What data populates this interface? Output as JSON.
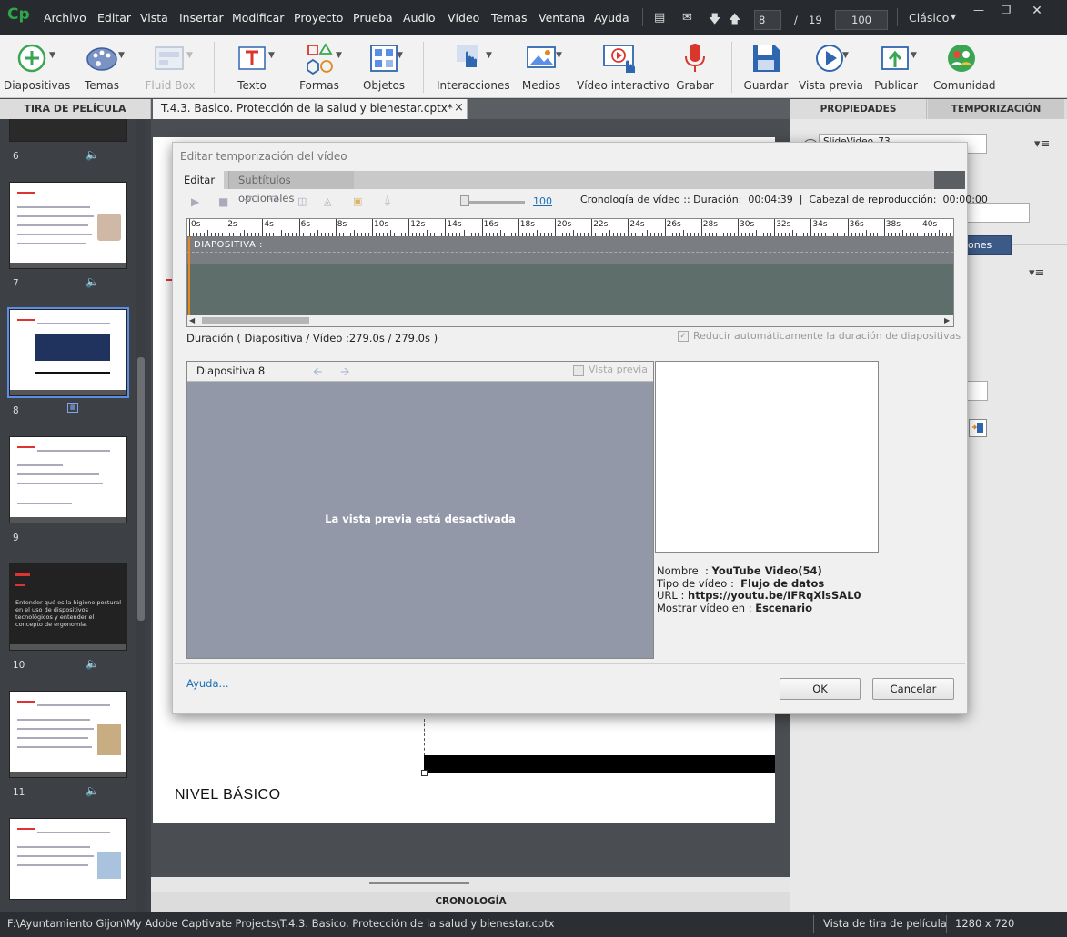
{
  "menubar": {
    "logo": "Cp",
    "items": [
      "Archivo",
      "Editar",
      "Vista",
      "Insertar",
      "Modificar",
      "Proyecto",
      "Prueba",
      "Audio",
      "Vídeo",
      "Temas",
      "Ventana",
      "Ayuda"
    ],
    "current_slide": "8",
    "slide_sep": "/",
    "total_slides": "19",
    "zoom": "100",
    "workspace": "Clásico"
  },
  "toolbar": {
    "items": [
      {
        "label": "Diapositivas",
        "icon": "add-slide-icon"
      },
      {
        "label": "Temas",
        "icon": "palette-icon"
      },
      {
        "label": "Fluid Box",
        "icon": "fluid-box-icon"
      },
      {
        "label": "Texto",
        "icon": "text-icon"
      },
      {
        "label": "Formas",
        "icon": "shapes-icon"
      },
      {
        "label": "Objetos",
        "icon": "objects-icon"
      },
      {
        "label": "Interacciones",
        "icon": "hand-pointer-icon"
      },
      {
        "label": "Medios",
        "icon": "image-icon"
      },
      {
        "label": "Vídeo interactivo",
        "icon": "interactive-video-icon"
      },
      {
        "label": "Grabar",
        "icon": "microphone-icon"
      },
      {
        "label": "Guardar",
        "icon": "save-icon"
      },
      {
        "label": "Vista previa",
        "icon": "play-icon"
      },
      {
        "label": "Publicar",
        "icon": "publish-icon"
      },
      {
        "label": "Comunidad",
        "icon": "community-icon"
      }
    ]
  },
  "filmstrip": {
    "title": "TIRA DE PELÍCULA",
    "slides": [
      "6",
      "7",
      "8",
      "9",
      "10",
      "11"
    ],
    "slide10_heading": "Entender qué es la higiene postural en el uso de dispositivos tecnológicos y entender el concepto de ergonomía."
  },
  "document_tab": {
    "title": "T.4.3. Basico. Protección de la salud y bienestar.cptx*",
    "close": "×"
  },
  "stage": {
    "footer_text": "NIVEL BÁSICO",
    "timeline_label": "CRONOLOGÍA"
  },
  "right_panel": {
    "tabs": [
      "PROPIEDADES",
      "TEMPORIZACIÓN"
    ],
    "name_field": "SlideVideo_73",
    "partial_button": "ones"
  },
  "dialog": {
    "title": "Editar temporización del vídeo",
    "tabs": [
      "Editar",
      "Subtítulos opcionales"
    ],
    "zoom_value": "100",
    "timeline_info": "Cronología de vídeo :: Duración:  00:04:39  |  Cabezal de reproducción:  00:00:00",
    "ruler_labels": [
      "0s",
      "2s",
      "4s",
      "6s",
      "8s",
      "10s",
      "12s",
      "14s",
      "16s",
      "18s",
      "20s",
      "22s",
      "24s",
      "26s",
      "28s",
      "30s",
      "32s",
      "34s",
      "36s",
      "38s",
      "40s"
    ],
    "track_label": "DIAPOSITIVA :",
    "duration_text": "Duración ( Diapositiva / Vídeo  :279.0s / 279.0s )",
    "auto_reduce_label": "Reducir automáticamente la duración de diapositivas",
    "auto_reduce_checked": true,
    "preview_slide": "Diapositiva 8",
    "preview_checkbox": "Vista previa",
    "preview_disabled_text": "La vista previa está desactivada",
    "info": [
      {
        "label": "Nombre  : ",
        "value": "YouTube Video(54)"
      },
      {
        "label": "Tipo de vídeo :  ",
        "value": "Flujo de datos"
      },
      {
        "label": "URL : ",
        "value": "https://youtu.be/IFRqXlsSAL0"
      },
      {
        "label": "Mostrar vídeo en : ",
        "value": "Escenario"
      }
    ],
    "help_link": "Ayuda...",
    "ok": "OK",
    "cancel": "Cancelar"
  },
  "statusbar": {
    "path": "F:\\Ayuntamiento Gijon\\My Adobe Captivate Projects\\T.4.3. Basico. Protección de la salud y bienestar.cptx",
    "view": "Vista de tira de película",
    "resolution": "1280 x 720"
  },
  "colors": {
    "accent": "#2ea64a",
    "selection": "#5b8fe6",
    "link": "#1d6fb5"
  }
}
